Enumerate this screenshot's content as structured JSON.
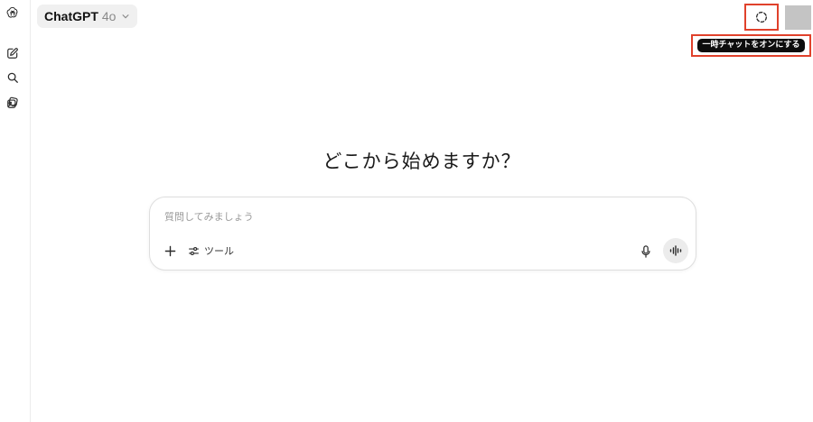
{
  "sidebar": {
    "icons": [
      "openai-logo-icon",
      "new-chat-icon",
      "search-icon",
      "library-icon"
    ]
  },
  "header": {
    "model_name": "ChatGPT",
    "model_version": "4o",
    "temporary_chat_icon": "dashed-circle-icon",
    "temporary_chat_tooltip": "一時チャットをオンにする"
  },
  "main": {
    "heading": "どこから始めますか？",
    "composer": {
      "placeholder": "質問してみましょう",
      "tools_label": "ツール",
      "icons": [
        "plus-icon",
        "sliders-icon",
        "microphone-icon",
        "voice-wave-icon"
      ]
    }
  },
  "colors": {
    "highlight_border": "#e0412b",
    "tooltip_bg": "#0d0d0d",
    "model_chip_bg": "#f0f0f0",
    "avatar_placeholder": "#c4c4c4"
  }
}
